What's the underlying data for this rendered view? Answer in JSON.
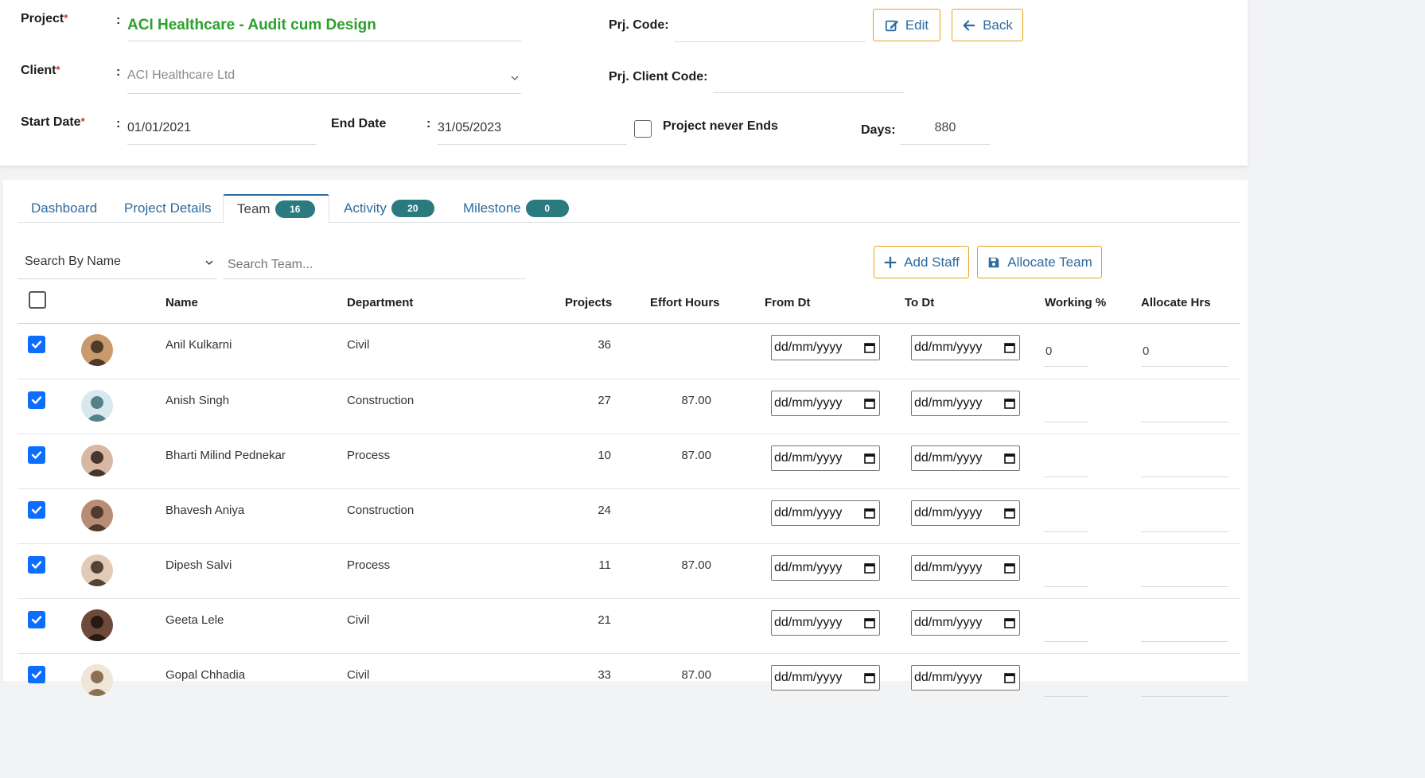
{
  "project": {
    "project_label": "Project",
    "project_value": "ACI Healthcare - Audit cum Design",
    "client_label": "Client",
    "client_value": "ACI Healthcare Ltd",
    "start_label": "Start Date",
    "start_value": "01/01/2021",
    "end_label": "End Date",
    "end_value": "31/05/2023",
    "prj_code_label": "Prj. Code:",
    "prj_code_value": "",
    "prj_client_code_label": "Prj. Client Code:",
    "prj_client_code_value": "",
    "never_ends_label": "Project never Ends",
    "days_label": "Days:",
    "days_value": "880",
    "required_mark": "*",
    "colon": ":"
  },
  "actions": {
    "edit_label": "Edit",
    "back_label": "Back"
  },
  "tabs": [
    {
      "label": "Dashboard",
      "badge": null
    },
    {
      "label": "Project Details",
      "badge": null
    },
    {
      "label": "Team",
      "badge": "16"
    },
    {
      "label": "Activity",
      "badge": "20"
    },
    {
      "label": "Milestone",
      "badge": "0"
    }
  ],
  "toolbar": {
    "search_by": "Search By Name",
    "search_placeholder": "Search Team...",
    "add_staff_label": "Add Staff",
    "allocate_team_label": "Allocate Team"
  },
  "table": {
    "headers": [
      "Name",
      "Department",
      "Projects",
      "Effort Hours",
      "From Dt",
      "To Dt",
      "Working %",
      "Allocate Hrs"
    ],
    "date_placeholder": "dd/mm/yyyy",
    "rows": [
      {
        "name": "Anil Kulkarni",
        "department": "Civil",
        "projects": "36",
        "effort": "",
        "working": "0",
        "allocate": "0"
      },
      {
        "name": "Anish Singh",
        "department": "Construction",
        "projects": "27",
        "effort": "87.00",
        "working": "",
        "allocate": ""
      },
      {
        "name": "Bharti Milind Pednekar",
        "department": "Process",
        "projects": "10",
        "effort": "87.00",
        "working": "",
        "allocate": ""
      },
      {
        "name": "Bhavesh Aniya",
        "department": "Construction",
        "projects": "24",
        "effort": "",
        "working": "",
        "allocate": ""
      },
      {
        "name": "Dipesh Salvi",
        "department": "Process",
        "projects": "11",
        "effort": "87.00",
        "working": "",
        "allocate": ""
      },
      {
        "name": "Geeta Lele",
        "department": "Civil",
        "projects": "21",
        "effort": "",
        "working": "",
        "allocate": ""
      },
      {
        "name": "Gopal Chhadia",
        "department": "Civil",
        "projects": "33",
        "effort": "87.00",
        "working": "",
        "allocate": ""
      }
    ]
  },
  "colors": {
    "accent": "#2d6a9f",
    "project_title": "#2ca02c",
    "badge": "#2a7a7f",
    "button_border": "#e8a317",
    "checkbox": "#0d6efd"
  }
}
